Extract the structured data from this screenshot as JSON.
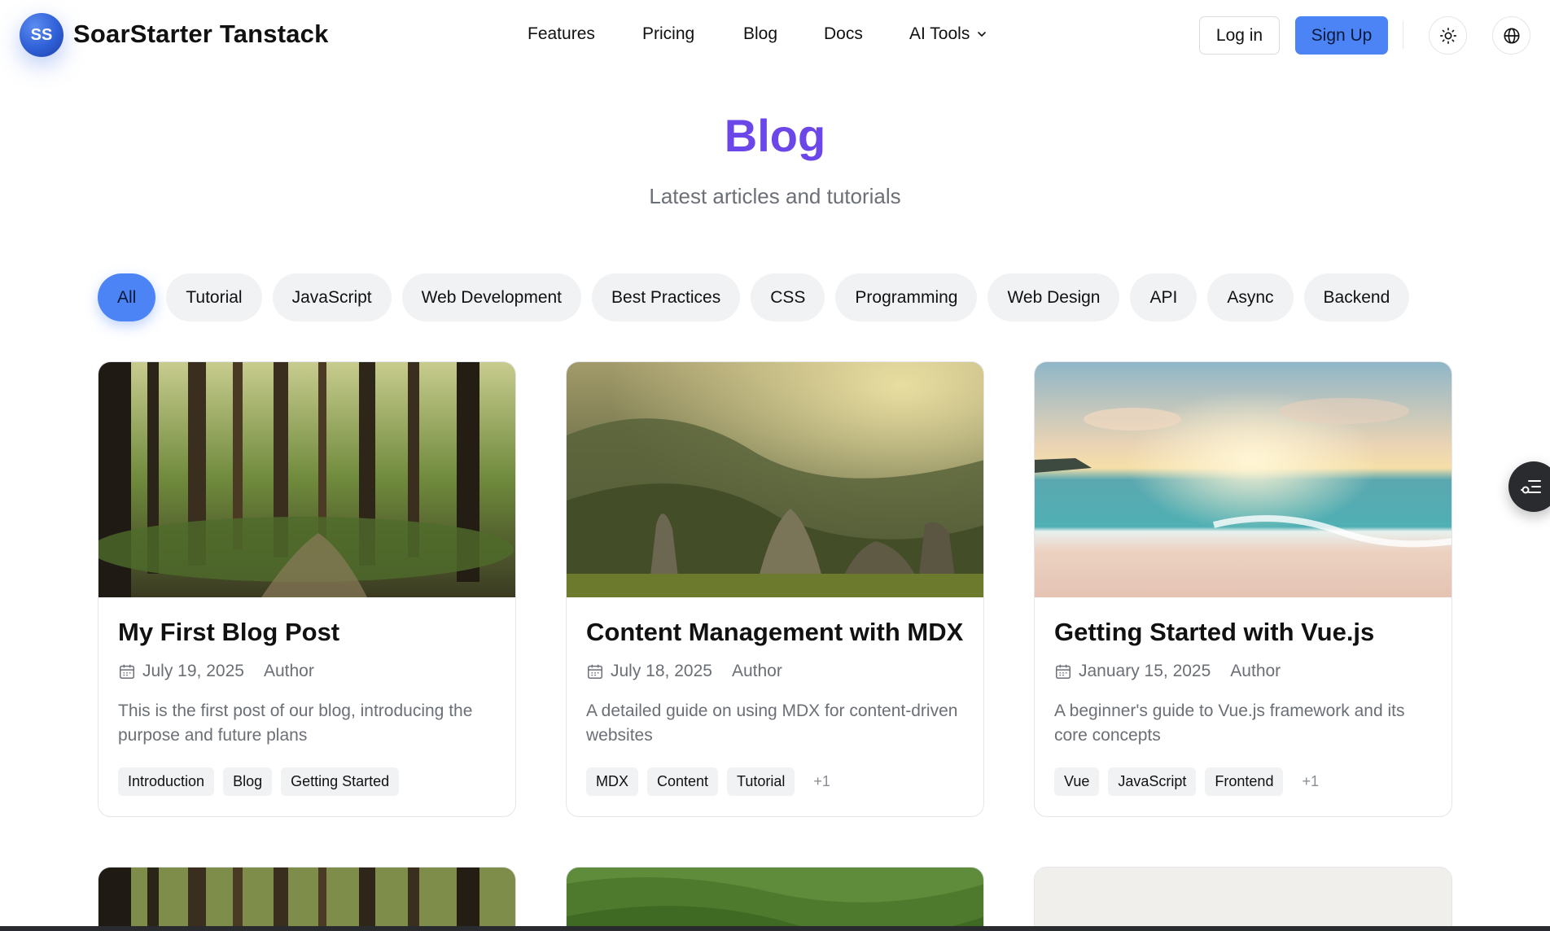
{
  "header": {
    "logo_text": "SS",
    "brand": "SoarStarter Tanstack",
    "nav": {
      "features": "Features",
      "pricing": "Pricing",
      "blog": "Blog",
      "docs": "Docs",
      "ai_tools": "AI Tools"
    },
    "login": "Log in",
    "signup": "Sign Up"
  },
  "hero": {
    "title": "Blog",
    "subtitle": "Latest articles and tutorials"
  },
  "filters": [
    "All",
    "Tutorial",
    "JavaScript",
    "Web Development",
    "Best Practices",
    "CSS",
    "Programming",
    "Web Design",
    "API",
    "Async",
    "Backend"
  ],
  "posts": [
    {
      "title": "My First Blog Post",
      "date": "July 19, 2025",
      "author": "Author",
      "description": "This is the first post of our blog, introducing the purpose and future plans",
      "tags": [
        "Introduction",
        "Blog",
        "Getting Started"
      ],
      "more": ""
    },
    {
      "title": "Content Management with MDX",
      "date": "July 18, 2025",
      "author": "Author",
      "description": "A detailed guide on using MDX for content-driven websites",
      "tags": [
        "MDX",
        "Content",
        "Tutorial"
      ],
      "more": "+1"
    },
    {
      "title": "Getting Started with Vue.js",
      "date": "January 15, 2025",
      "author": "Author",
      "description": "A beginner's guide to Vue.js framework and its core concepts",
      "tags": [
        "Vue",
        "JavaScript",
        "Frontend"
      ],
      "more": "+1"
    }
  ],
  "colors": {
    "accent": "#4d84f5",
    "title_purple": "#6b46e8"
  }
}
